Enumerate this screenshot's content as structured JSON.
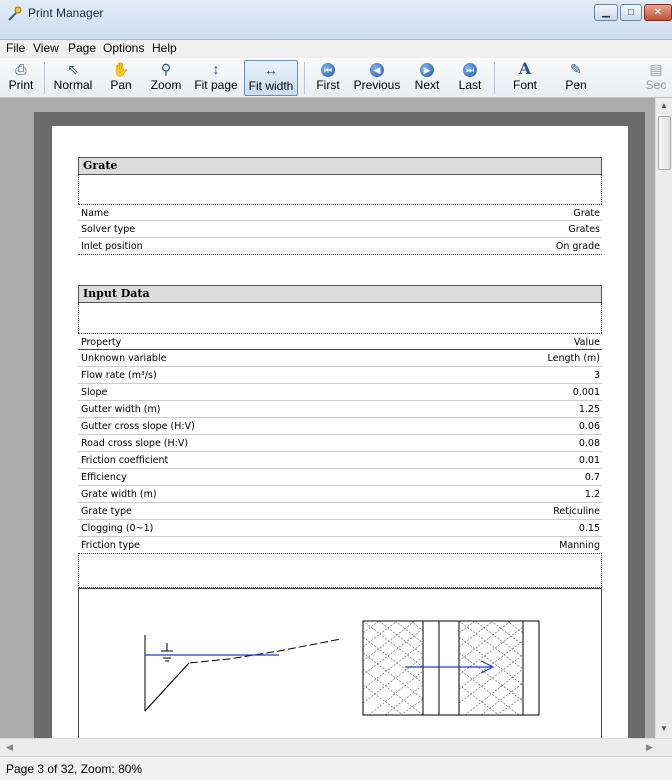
{
  "window": {
    "title": "Print Manager"
  },
  "menu": [
    "File",
    "View",
    "Page",
    "Options",
    "Help"
  ],
  "toolbar": {
    "print": "Print",
    "normal": "Normal",
    "pan": "Pan",
    "zoom": "Zoom",
    "fit_page": "Fit page",
    "fit_width": "Fit width",
    "first": "First",
    "previous": "Previous",
    "next": "Next",
    "last": "Last",
    "font": "Font",
    "pen": "Pen",
    "sections": "Sec"
  },
  "report": {
    "grate_section": {
      "title": "Grate",
      "rows": [
        {
          "key": "Name",
          "value": "Grate"
        },
        {
          "key": "Solver type",
          "value": "Grates"
        },
        {
          "key": "Inlet position",
          "value": "On grade"
        }
      ]
    },
    "input_section": {
      "title": "Input Data",
      "header": {
        "key": "Property",
        "value": "Value"
      },
      "rows": [
        {
          "key": "Unknown variable",
          "value": "Length (m)"
        },
        {
          "key": "Flow rate (m³/s)",
          "value": "3"
        },
        {
          "key": "Slope",
          "value": "0.001"
        },
        {
          "key": "Gutter width (m)",
          "value": "1.25"
        },
        {
          "key": "Gutter cross slope (H:V)",
          "value": "0.06"
        },
        {
          "key": "Road cross slope (H:V)",
          "value": "0.08"
        },
        {
          "key": "Friction coefficient",
          "value": "0.01"
        },
        {
          "key": "Efficiency",
          "value": "0.7"
        },
        {
          "key": "Grate width (m)",
          "value": "1.2"
        },
        {
          "key": "Grate type",
          "value": "Reticuline"
        },
        {
          "key": "Clogging (0~1)",
          "value": "0.15"
        },
        {
          "key": "Friction type",
          "value": "Manning"
        }
      ]
    }
  },
  "status": {
    "text": "Page 3 of 32, Zoom: 80%"
  },
  "colors": {
    "accent": "#2b4f83",
    "water": "#1a3fd8"
  }
}
